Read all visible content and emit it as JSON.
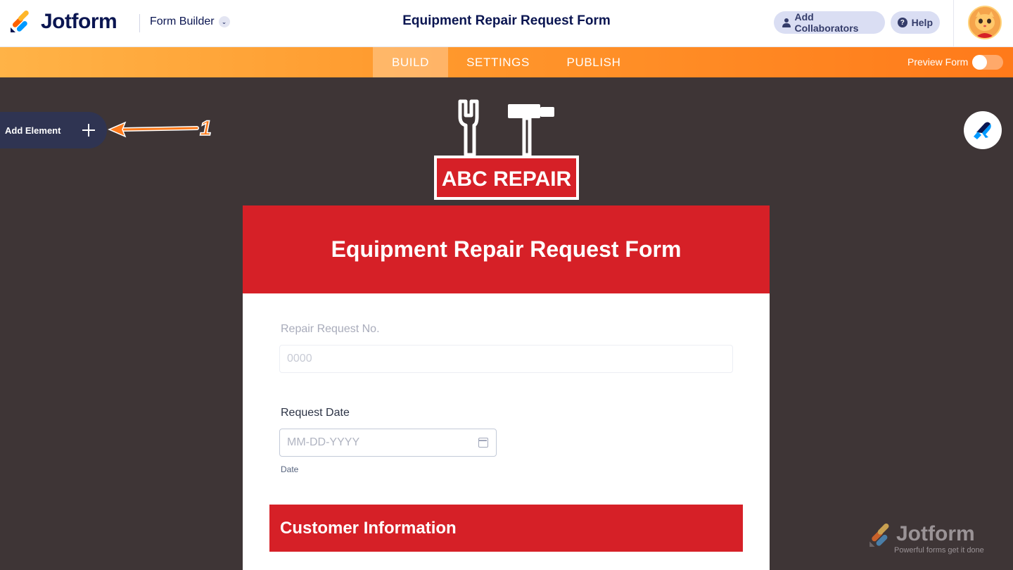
{
  "header": {
    "brand": "Jotform",
    "builder_label": "Form Builder",
    "title": "Equipment Repair Request Form",
    "add_collaborators": "Add Collaborators",
    "help": "Help"
  },
  "nav": {
    "tabs": [
      "BUILD",
      "SETTINGS",
      "PUBLISH"
    ],
    "active_tab": "BUILD",
    "preview_label": "Preview Form",
    "preview_enabled": false
  },
  "sidebar": {
    "add_element_label": "Add Element",
    "annotation_number": "1"
  },
  "form": {
    "logo_text": "ABC REPAIR",
    "title": "Equipment Repair Request Form",
    "fields": [
      {
        "label": "Repair Request No.",
        "placeholder": "0000",
        "disabled": true
      },
      {
        "label": "Request Date",
        "placeholder": "MM-DD-YYYY",
        "sublabel": "Date"
      }
    ],
    "section_title": "Customer Information"
  },
  "watermark": {
    "brand": "Jotform",
    "tagline": "Powerful forms get it done"
  },
  "colors": {
    "brand_navy": "#0a1551",
    "nav_orange": "#ff7a1a",
    "form_red": "#d62027",
    "canvas_bg": "#3e3536"
  },
  "icons": [
    "jotform-logo-icon",
    "chevron-down-icon",
    "person-icon",
    "help-icon",
    "avatar",
    "plus-icon",
    "paint-roller-icon",
    "calendar-icon"
  ]
}
